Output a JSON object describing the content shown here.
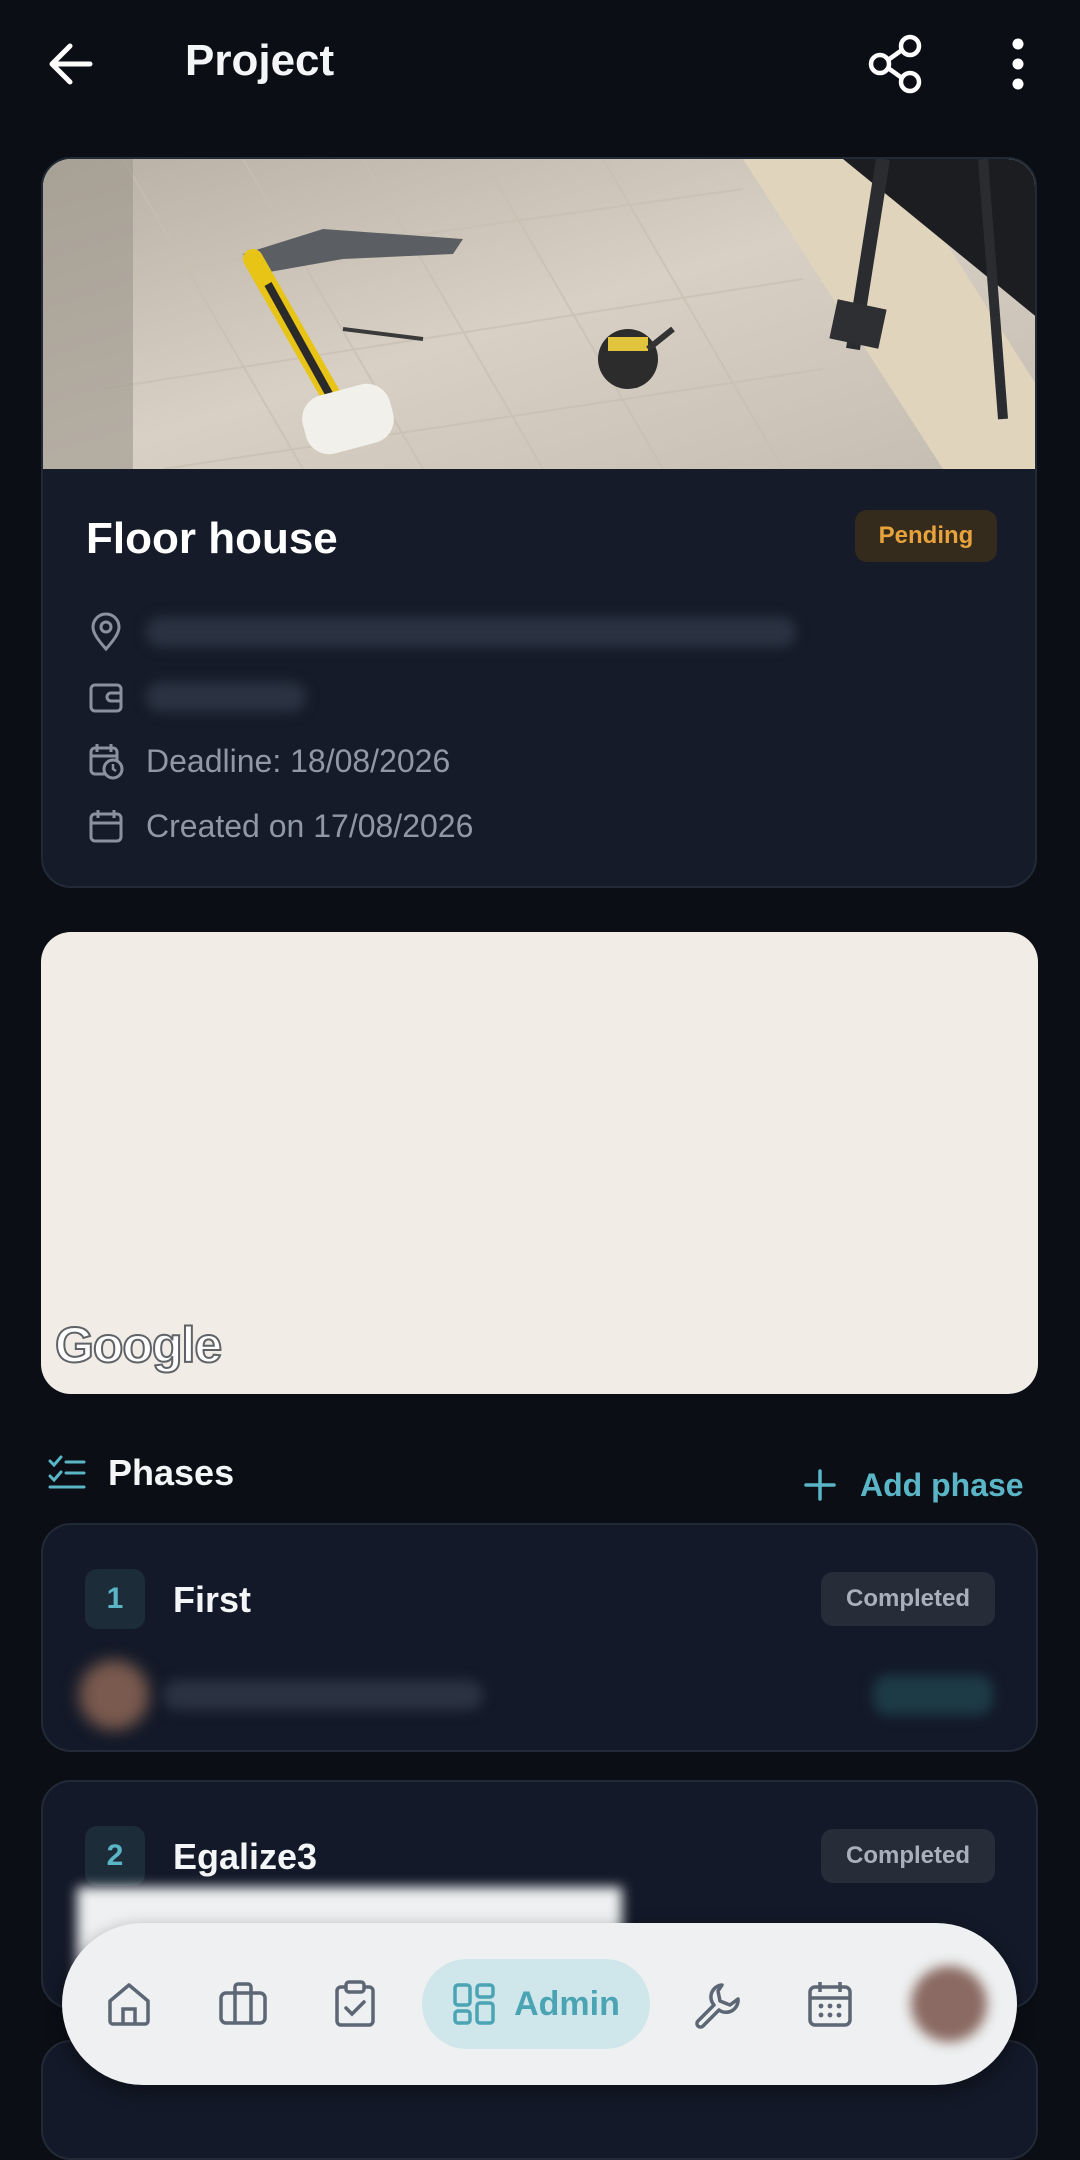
{
  "header": {
    "title": "Project",
    "back_icon": "arrow-left-icon",
    "share_icon": "share-icon",
    "more_icon": "more-vertical-icon"
  },
  "project": {
    "name": "Floor house",
    "status": "Pending",
    "deadline": "Deadline: 18/08/2026",
    "created": "Created on 17/08/2026",
    "colors": {
      "status_text": "#e8a23c",
      "status_bg": "#342b1d"
    }
  },
  "map": {
    "logo": "Google"
  },
  "phases": {
    "title": "Phases",
    "add_label": "Add phase",
    "items": [
      {
        "number": "1",
        "name": "First",
        "status": "Completed"
      },
      {
        "number": "2",
        "name": "Egalize3",
        "status": "Completed"
      }
    ]
  },
  "nav": {
    "items": [
      "home-icon",
      "briefcase-icon",
      "clipboard-check-icon",
      "dashboard-icon",
      "wrench-icon",
      "calendar-icon",
      "avatar"
    ],
    "active_label": "Admin",
    "accent": "#4aa4b4"
  }
}
